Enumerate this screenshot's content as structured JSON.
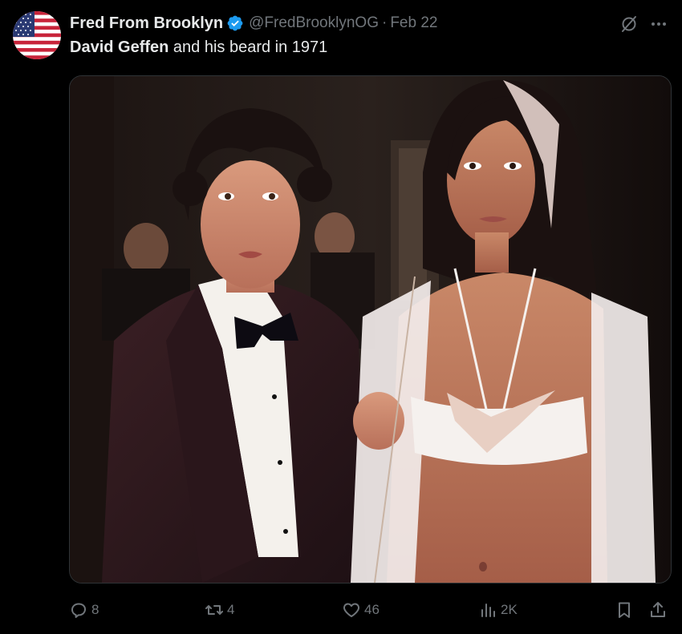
{
  "tweet": {
    "author": {
      "display_name": "Fred From Brooklyn",
      "handle": "@FredBrooklynOG",
      "separator": "·",
      "date": "Feb 22",
      "verified": true,
      "avatar_icon": "us-flag-avatar"
    },
    "text": {
      "bold_part": "David Geffen",
      "rest": " and his beard in 1971"
    },
    "media": {
      "type": "photo"
    },
    "actions": {
      "replies": "8",
      "reposts": "4",
      "likes": "46",
      "views": "2K"
    },
    "icons": {
      "reply": "reply-icon",
      "repost": "repost-icon",
      "like": "heart-icon",
      "views": "views-icon",
      "bookmark": "bookmark-icon",
      "share": "share-icon",
      "grok": "grok-icon",
      "more": "more-icon",
      "verified": "verified-badge-icon"
    },
    "colors": {
      "background": "#000000",
      "text": "#e7e9ea",
      "muted": "#71767b",
      "verified": "#1d9bf0"
    }
  }
}
